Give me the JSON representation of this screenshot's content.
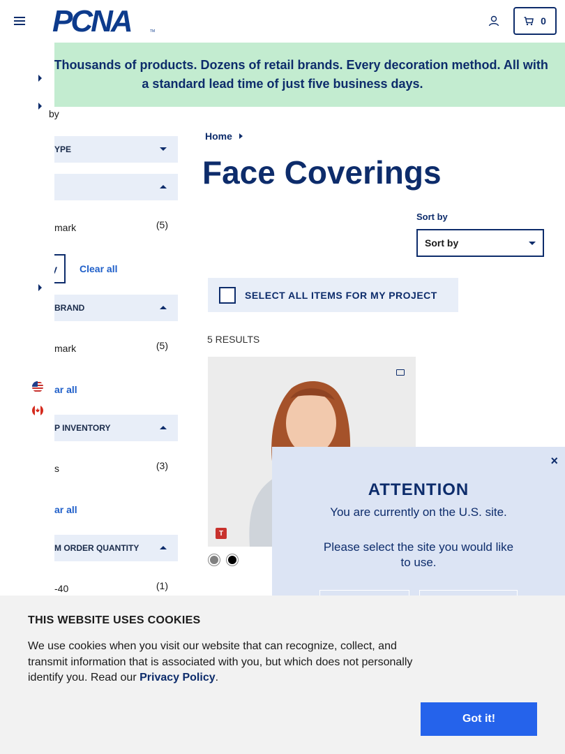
{
  "header": {
    "logo_text": "PCNA",
    "logo_tm": "TM",
    "cart_count": "0"
  },
  "banner": {
    "text": "Wait? Thousands of products. Dozens of retail brands. Every decoration method. All with a standard lead time of just five business days."
  },
  "side_menu": {
    "partial_label": "by"
  },
  "filters": {
    "product_type_label": "YPE",
    "second_group_label": "",
    "trademark_option": "mark",
    "trademark_count": "(5)",
    "apply_label": "y",
    "clear_all": "Clear all",
    "retail_brand_label": "BRAND",
    "brand_option": "mark",
    "brand_count": "(5)",
    "clear_all_2": "ar all",
    "inventory_label": "P INVENTORY",
    "inventory_option": "s",
    "inventory_count": "(3)",
    "clear_all_3": "ar all",
    "moq_label": "M ORDER QUANTITY",
    "moq_option": "-40",
    "moq_count": "(1)"
  },
  "breadcrumb": {
    "home": "Home"
  },
  "page_title": "Face Coverings",
  "sort": {
    "label": "Sort by",
    "selected": "Sort by"
  },
  "select_all_label": "SELECT ALL ITEMS FOR MY PROJECT",
  "results_count": "5 RESULTS",
  "product": {
    "tag": "T",
    "swatch_colors": [
      "#808080",
      "#000000"
    ]
  },
  "modal": {
    "close": "×",
    "title": "ATTENTION",
    "line1": "You are currently on the U.S. site.",
    "line2": "Please select the site you would like to use."
  },
  "cookie": {
    "title": "THIS WEBSITE USES COOKIES",
    "text": "We use cookies when you visit our website that can recognize, collect, and transmit information that is associated with you, but which does not personally identify you. Read our ",
    "link": "Privacy Policy",
    "period": ".",
    "button": "Got it!"
  },
  "colors": {
    "navy": "#0d2c6b",
    "banner_bg": "#c3ecd0",
    "filter_bg": "#e8eef8",
    "modal_bg": "#dce4f4",
    "cta_blue": "#2563eb"
  }
}
